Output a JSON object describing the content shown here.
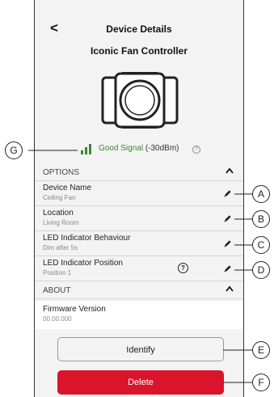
{
  "header": {
    "back_icon": "chevron-left-icon",
    "back_glyph": "<",
    "title": "Device Details",
    "device_name": "Iconic Fan Controller"
  },
  "signal": {
    "icon": "signal-bars-icon",
    "status": "Good Signal",
    "strength": "(-30dBm)",
    "info_glyph": "?",
    "color": "#3a8a2c"
  },
  "options": {
    "heading": "OPTIONS",
    "rows": [
      {
        "label": "Device Name",
        "value": "Ceiling Fan"
      },
      {
        "label": "Location",
        "value": "Living Room"
      },
      {
        "label": "LED Indicator Behaviour",
        "value": "Dim after 5s"
      },
      {
        "label": "LED Indicator Position",
        "value": "Position 1",
        "help_glyph": "?"
      }
    ]
  },
  "about": {
    "heading": "ABOUT",
    "firmware_label": "Firmware Version",
    "firmware_value": "00.00.000"
  },
  "buttons": {
    "identify": "Identify",
    "delete": "Delete",
    "delete_color": "#d9142b"
  },
  "callouts": {
    "a": "A",
    "b": "B",
    "c": "C",
    "d": "D",
    "e": "E",
    "f": "F",
    "g": "G"
  }
}
